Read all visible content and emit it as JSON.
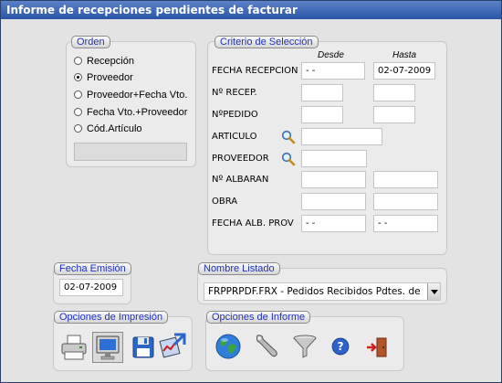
{
  "window": {
    "title": "Informe de recepciones pendientes de facturar"
  },
  "orden": {
    "title": "Orden",
    "options": [
      "Recepción",
      "Proveedor",
      "Proveedor+Fecha Vto.",
      "Fecha Vto.+Proveedor",
      "Cód.Artículo"
    ],
    "selected": "Proveedor"
  },
  "criterio": {
    "title": "Criterio de Selección",
    "desde_header": "Desde",
    "hasta_header": "Hasta",
    "rows": {
      "fecha_recepcion": {
        "label": "FECHA RECEPCION",
        "desde": " -  - ",
        "hasta": "02-07-2009"
      },
      "n_recep": {
        "label": "Nº  RECEP.",
        "desde": "",
        "hasta": ""
      },
      "n_pedido": {
        "label": "NºPEDIDO",
        "desde": "",
        "hasta": ""
      },
      "articulo": {
        "label": "ARTICULO",
        "value": ""
      },
      "proveedor": {
        "label": "PROVEEDOR",
        "value": ""
      },
      "n_albaran": {
        "label": "Nº ALBARAN",
        "desde": "",
        "hasta": ""
      },
      "obra": {
        "label": "OBRA",
        "desde": "",
        "hasta": ""
      },
      "fecha_alb_prov": {
        "label": "FECHA ALB. PROV",
        "desde": " -  - ",
        "hasta": " -  - "
      }
    }
  },
  "fecha_emision": {
    "title": "Fecha Emisión",
    "value": "02-07-2009"
  },
  "nombre_listado": {
    "title": "Nombre Listado",
    "value": "FRPPRPDF.FRX - Pedidos Recibidos Pdtes. de"
  },
  "opciones_impresion": {
    "title": "Opciones de Impresión",
    "buttons": [
      "printer-icon",
      "monitor-icon",
      "floppy-disk-icon",
      "export-icon"
    ],
    "pressed": "monitor-icon"
  },
  "opciones_informe": {
    "title": "Opciones de Informe",
    "buttons": [
      "globe-icon",
      "wrench-icon",
      "filter-funnel-icon",
      "help-icon",
      "exit-door-icon"
    ]
  }
}
